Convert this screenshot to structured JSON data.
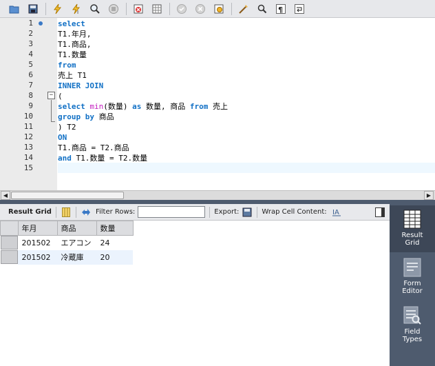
{
  "toolbar": {
    "icons": [
      "open-folder-icon",
      "save-icon",
      "execute-icon",
      "execute-current-icon",
      "explain-icon",
      "stop-icon",
      "toggle-error-icon",
      "toggle-autocommit-icon",
      "commit-icon",
      "rollback-icon",
      "limit-icon",
      "beautify-icon",
      "find-icon",
      "invisible-chars-icon",
      "wrap-icon"
    ]
  },
  "editor": {
    "line_numbers": [
      "1",
      "2",
      "3",
      "4",
      "5",
      "6",
      "7",
      "8",
      "9",
      "10",
      "11",
      "12",
      "13",
      "14",
      "15"
    ],
    "lines": [
      [
        {
          "t": "select",
          "c": "kw"
        }
      ],
      [
        {
          "t": "T1.年月,",
          "c": ""
        }
      ],
      [
        {
          "t": "T1.商品,",
          "c": ""
        }
      ],
      [
        {
          "t": "T1.数量",
          "c": ""
        }
      ],
      [
        {
          "t": "from",
          "c": "kw"
        }
      ],
      [
        {
          "t": "売上 T1",
          "c": ""
        }
      ],
      [
        {
          "t": "INNER JOIN",
          "c": "kw"
        }
      ],
      [
        {
          "t": "(",
          "c": ""
        }
      ],
      [
        {
          "t": "select ",
          "c": "kw"
        },
        {
          "t": "min",
          "c": "fn"
        },
        {
          "t": "(数量) ",
          "c": ""
        },
        {
          "t": "as",
          "c": "kw"
        },
        {
          "t": " 数量, 商品 ",
          "c": ""
        },
        {
          "t": "from",
          "c": "kw"
        },
        {
          "t": " 売上",
          "c": ""
        }
      ],
      [
        {
          "t": "group by",
          "c": "kw"
        },
        {
          "t": " 商品",
          "c": ""
        }
      ],
      [
        {
          "t": ") T2",
          "c": ""
        }
      ],
      [
        {
          "t": "ON",
          "c": "kw"
        }
      ],
      [
        {
          "t": "T1.商品 = T2.商品",
          "c": ""
        }
      ],
      [
        {
          "t": "and",
          "c": "kw"
        },
        {
          "t": " T1.数量 = T2.数量",
          "c": ""
        }
      ],
      [
        {
          "t": "",
          "c": ""
        }
      ]
    ]
  },
  "result_toolbar": {
    "result_grid_label": "Result Grid",
    "filter_label": "Filter Rows:",
    "filter_value": "",
    "export_label": "Export:",
    "wrap_label": "Wrap Cell Content:"
  },
  "grid": {
    "columns": [
      "年月",
      "商品",
      "数量"
    ],
    "rows": [
      [
        "201502",
        "エアコン",
        "24"
      ],
      [
        "201502",
        "冷蔵庫",
        "20"
      ]
    ]
  },
  "side_panel": {
    "items": [
      {
        "label1": "Result",
        "label2": "Grid",
        "icon": "result-grid-icon"
      },
      {
        "label1": "Form",
        "label2": "Editor",
        "icon": "form-editor-icon"
      },
      {
        "label1": "Field",
        "label2": "Types",
        "icon": "field-types-icon"
      }
    ]
  },
  "colors": {
    "keyword": "#1170c5",
    "function": "#c41dc0",
    "side_panel": "#4e5b6e"
  }
}
